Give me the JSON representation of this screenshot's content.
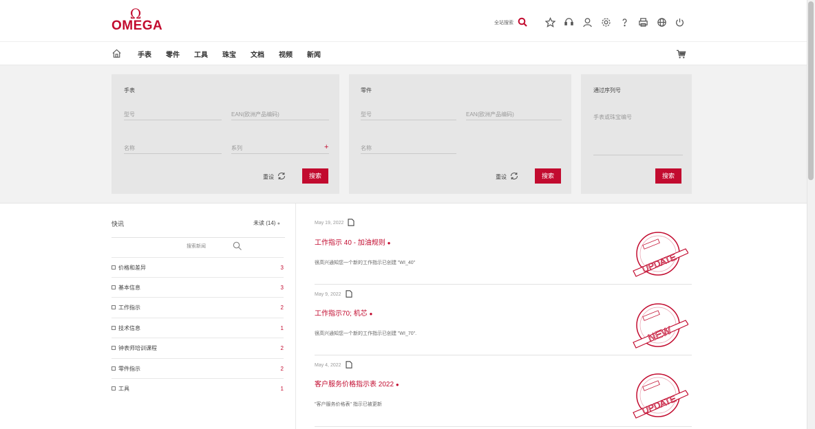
{
  "header": {
    "logo_symbol": "Ω",
    "logo_text": "OMEGA",
    "site_search_label": "全站搜索",
    "icons": [
      "search-icon",
      "star-icon",
      "headset-icon",
      "user-icon",
      "settings-icon",
      "help-icon",
      "print-icon",
      "globe-icon",
      "power-icon"
    ]
  },
  "nav": {
    "items": [
      "手表",
      "零件",
      "工具",
      "珠宝",
      "文档",
      "视频",
      "新闻"
    ]
  },
  "search": {
    "watches": {
      "title": "手表",
      "model_placeholder": "型号",
      "ean_placeholder": "EAN(欧洲产品编码)",
      "name_placeholder": "名称",
      "series_placeholder": "系列",
      "plus": "+",
      "reset_label": "重设",
      "search_label": "搜索"
    },
    "parts": {
      "title": "零件",
      "model_placeholder": "型号",
      "ean_placeholder": "EAN(欧洲产品编码)",
      "name_placeholder": "名称",
      "reset_label": "重设",
      "search_label": "搜索"
    },
    "serial": {
      "title": "通过序列号",
      "number_placeholder": "手表或珠宝编号",
      "search_label": "搜索"
    }
  },
  "quick_news": {
    "title": "快讯",
    "unread": "未读 (14)",
    "unread_dot": "●",
    "search_placeholder": "搜索新闻",
    "categories": [
      {
        "label": "价格和差异",
        "count": "3"
      },
      {
        "label": "基本信息",
        "count": "3"
      },
      {
        "label": "工作指示",
        "count": "2"
      },
      {
        "label": "技术信息",
        "count": "1"
      },
      {
        "label": "钟表师培训课程",
        "count": "2"
      },
      {
        "label": "零件指示",
        "count": "2"
      },
      {
        "label": "工具",
        "count": "1"
      }
    ]
  },
  "news": [
    {
      "date": "May 19, 2022",
      "title": "工作指示 40 - 加油规则",
      "dot": "●",
      "desc": "很高兴通知您一个新的工作指示已创建 \"WI_40\"",
      "badge": "UPDATE"
    },
    {
      "date": "May 9, 2022",
      "title": "工作指示70; 机芯",
      "dot": "●",
      "desc": "很高兴通知您一个新的工作指示已创建 \"WI_70\".",
      "badge": "NEW"
    },
    {
      "date": "May 4, 2022",
      "title": "客户服务价格指示表 2022",
      "dot": "●",
      "desc": "\"客户服务价格表\" 指示已被更新",
      "badge": "UPDATE"
    }
  ],
  "colors": {
    "accent": "#c20b2f",
    "panel": "#e6e6e6",
    "band": "#f2f2f2"
  }
}
